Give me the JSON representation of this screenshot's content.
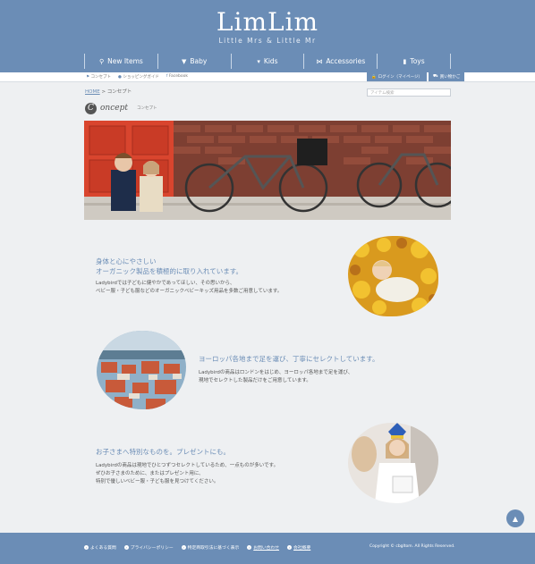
{
  "header": {
    "logo": "LimLim",
    "logo_sub": "Little Mrs & Little Mr",
    "nav": [
      {
        "label": "New Items",
        "icon": "pin-icon"
      },
      {
        "label": "Baby",
        "icon": "baby-icon"
      },
      {
        "label": "Kids",
        "icon": "shirt-icon"
      },
      {
        "label": "Accessories",
        "icon": "ribbon-icon"
      },
      {
        "label": "Toys",
        "icon": "toy-icon"
      }
    ]
  },
  "subbar": {
    "links": [
      "コンセプト",
      "ショッピングガイド",
      "Facebook"
    ],
    "login": "ログイン（マイページ）",
    "cart": "買い物かご"
  },
  "breadcrumb": {
    "home": "HOME",
    "sep": ">",
    "current": "コンセプト"
  },
  "search": {
    "placeholder": "アイテム検索"
  },
  "concept": {
    "initial": "C",
    "rest": "oncept",
    "jp": "コンセプト"
  },
  "sections": [
    {
      "title_line1": "身体と心にやさしい",
      "title_line2": "オーガニック製品を積極的に取り入れています。",
      "body_line1": "Ladybirdでは子どもに健やかであってほしい、その思いから、",
      "body_line2": "ベビー服・子ども服などのオーガニックベビーキッズ用品を多数ご用意しています。"
    },
    {
      "title_line1": "ヨーロッパ各地まで足を運び、丁寧にセレクトしています。",
      "body_line1": "Ladybirdの商品はロンドンをはじめ、ヨーロッパ各地まで足を運び、",
      "body_line2": "現地でセレクトした製品だけをご用意しています。"
    },
    {
      "title_line1": "お子さまへ特別なものを。プレゼントにも。",
      "body_line1": "Ladybirdの商品は現地でひとつずつセレクトしているため、一点ものが多いです。",
      "body_line2": "ぜひお子さまのために、またはプレゼント用に、",
      "body_line3": "特別で優しいベビー服・子ども服を見つけてください。"
    }
  ],
  "footer": {
    "links": [
      "よくある質問",
      "プライバシーポリシー",
      "特定商取引法に基づく表示",
      "お問い合わせ",
      "会社概要"
    ],
    "copyright": "Copyright © cbgltom. All Rights Reserved."
  },
  "colors": {
    "brand": "#6b8db6",
    "background": "#eef0f2"
  }
}
